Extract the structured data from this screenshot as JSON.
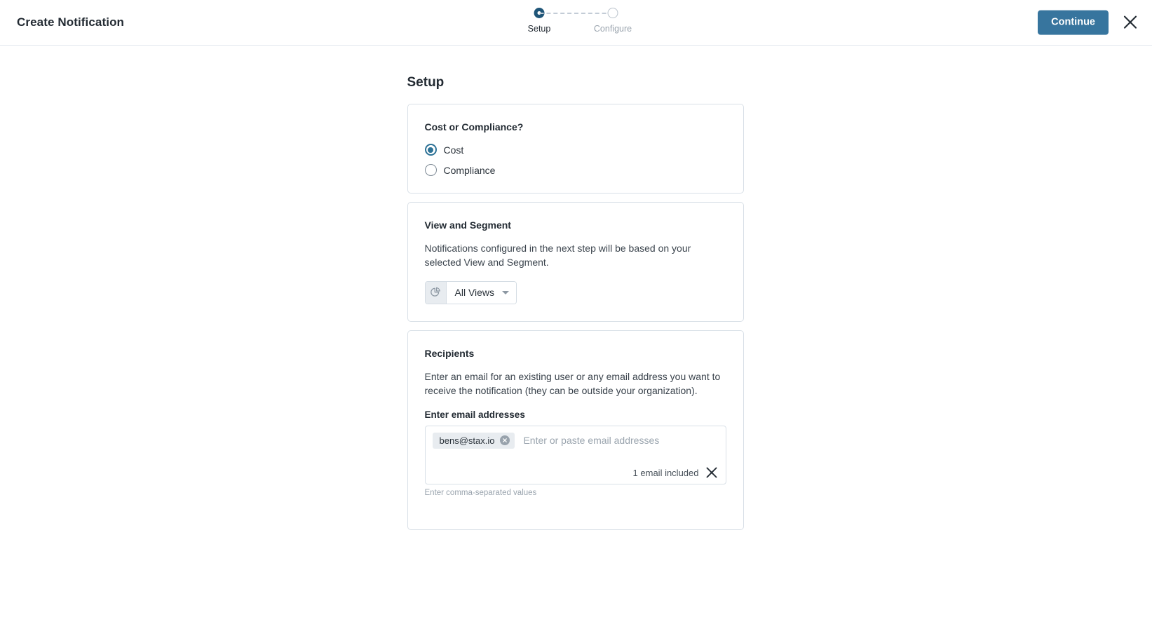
{
  "header": {
    "title": "Create Notification",
    "continue_label": "Continue",
    "close_icon": "close-icon",
    "stepper": {
      "steps": [
        {
          "label": "Setup",
          "state": "active"
        },
        {
          "label": "Configure",
          "state": "inactive"
        }
      ]
    }
  },
  "main": {
    "page_heading": "Setup",
    "cards": {
      "cost_or_compliance": {
        "title": "Cost or Compliance?",
        "options": [
          {
            "label": "Cost",
            "selected": true
          },
          {
            "label": "Compliance",
            "selected": false
          }
        ]
      },
      "view_and_segment": {
        "title": "View and Segment",
        "description": "Notifications configured in the next step will be based on your selected View and Segment.",
        "select": {
          "icon": "pie-chart-icon",
          "value": "All Views",
          "caret_icon": "chevron-down-icon"
        }
      },
      "recipients": {
        "title": "Recipients",
        "description": "Enter an email for an existing user or any email address you want to receive the notification (they can be outside your organization).",
        "field_label": "Enter email addresses",
        "placeholder": "Enter or paste email addresses",
        "tokens": [
          {
            "value": "bens@stax.io",
            "remove_icon": "remove-token-icon"
          }
        ],
        "count_text": "1 email included",
        "clear_icon": "clear-all-icon",
        "hint": "Enter comma-separated values"
      }
    }
  },
  "colors": {
    "accent_button": "#37759e",
    "step_active": "#1f5578",
    "radio_selected": "#2d7296",
    "card_border": "#d9e0e7",
    "text_primary": "#232b33",
    "text_muted": "#9aa4ae"
  }
}
